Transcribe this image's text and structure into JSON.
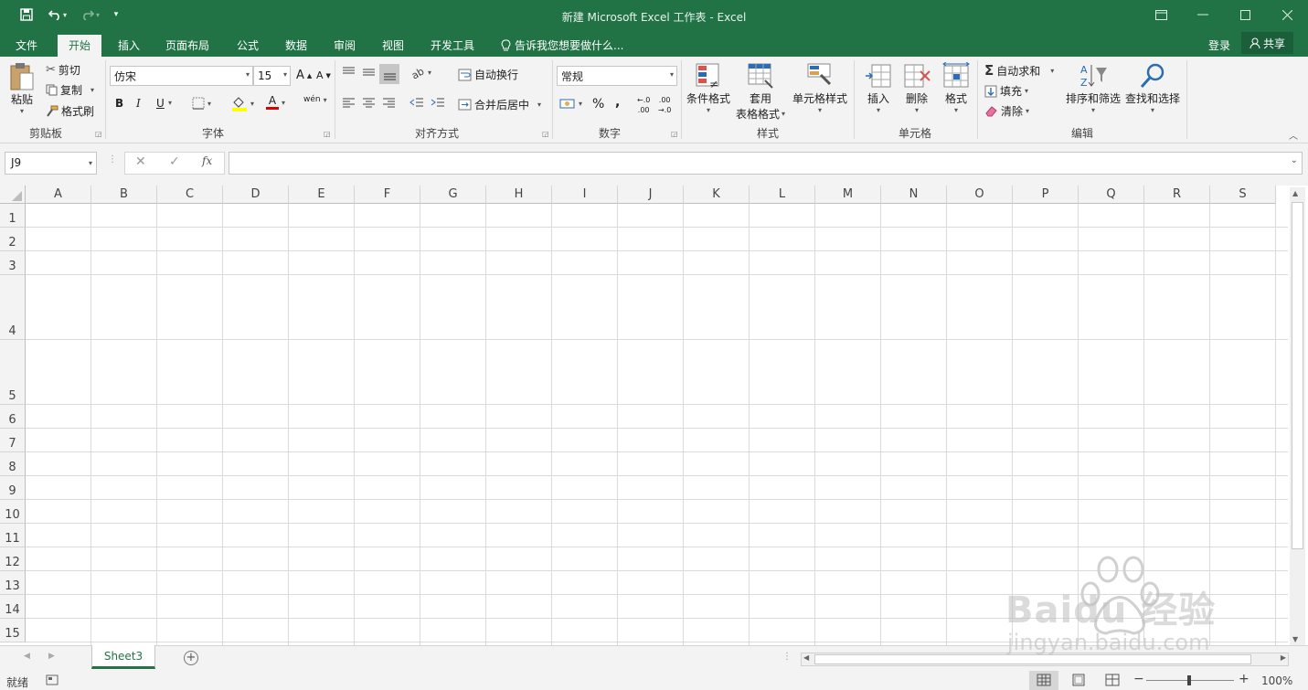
{
  "title_bar": {
    "document_title": "新建 Microsoft Excel 工作表 - Excel"
  },
  "tabs": [
    {
      "label": "文件"
    },
    {
      "label": "开始",
      "active": true
    },
    {
      "label": "插入"
    },
    {
      "label": "页面布局"
    },
    {
      "label": "公式"
    },
    {
      "label": "数据"
    },
    {
      "label": "审阅"
    },
    {
      "label": "视图"
    },
    {
      "label": "开发工具"
    }
  ],
  "tell_me": "告诉我您想要做什么...",
  "account": {
    "login": "登录",
    "share": "共享"
  },
  "ribbon": {
    "clipboard": {
      "label": "剪贴板",
      "paste": "粘贴",
      "cut": "剪切",
      "copy": "复制",
      "format_painter": "格式刷"
    },
    "font": {
      "label": "字体",
      "font_name": "仿宋",
      "font_size": "15",
      "bold": "B",
      "italic": "I",
      "underline": "U",
      "font_color": "A",
      "phonetic": "wén"
    },
    "alignment": {
      "label": "对齐方式",
      "wrap_text": "自动换行",
      "merge_center": "合并后居中"
    },
    "number": {
      "label": "数字",
      "format": "常规",
      "percent": "%",
      "comma": ","
    },
    "styles": {
      "label": "样式",
      "conditional": "条件格式",
      "table_format_1": "套用",
      "table_format_2": "表格格式",
      "cell_styles": "单元格样式"
    },
    "cells": {
      "label": "单元格",
      "insert": "插入",
      "delete": "删除",
      "format": "格式"
    },
    "editing": {
      "label": "编辑",
      "autosum": "自动求和",
      "fill": "填充",
      "clear": "清除",
      "sort_filter": "排序和筛选",
      "find_select": "查找和选择"
    }
  },
  "formula_bar": {
    "name_box": "J9",
    "fx": "fx",
    "formula": ""
  },
  "grid": {
    "columns": [
      "A",
      "B",
      "C",
      "D",
      "E",
      "F",
      "G",
      "H",
      "I",
      "J",
      "K",
      "L",
      "M",
      "N",
      "O",
      "P",
      "Q",
      "R",
      "S"
    ],
    "rows": [
      "1",
      "2",
      "3",
      "4",
      "5",
      "6",
      "7",
      "8",
      "9",
      "10",
      "11",
      "12",
      "13",
      "14",
      "15"
    ]
  },
  "sheets": [
    {
      "name": "Sheet3",
      "active": true
    }
  ],
  "status": {
    "ready": "就绪",
    "zoom": "100%"
  },
  "watermark": {
    "brand": "Baidu 经验",
    "url": "jingyan.baidu.com"
  },
  "colors": {
    "accent": "#217346",
    "ribbon_bg": "#f3f3f3"
  }
}
